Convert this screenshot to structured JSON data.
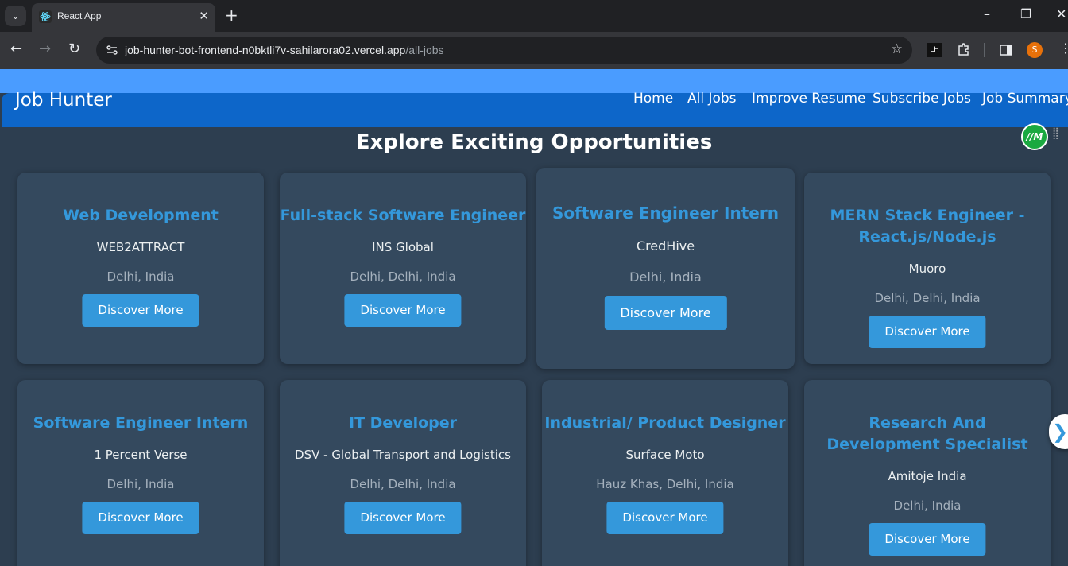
{
  "browser": {
    "tab_title": "React App",
    "url_host": "job-hunter-bot-frontend-n0bktli7v-sahilarora02.vercel.app",
    "url_path": "/all-jobs",
    "profile_initial": "S"
  },
  "navbar": {
    "brand": "Job Hunter",
    "links": [
      "Home",
      "All Jobs",
      "Improve Resume",
      "Subscribe Jobs",
      "Job Summary"
    ]
  },
  "page_heading": "Explore Exciting Opportunities",
  "jobs": [
    {
      "title": "Web Development",
      "company": "WEB2ATTRACT",
      "location": "Delhi, India",
      "button": "Discover More"
    },
    {
      "title": "Full-stack Software Engineer",
      "company": "INS Global",
      "location": "Delhi, Delhi, India",
      "button": "Discover More"
    },
    {
      "title": "Software Engineer Intern",
      "company": "CredHive",
      "location": "Delhi, India",
      "button": "Discover More"
    },
    {
      "title": "MERN Stack Engineer - React.js/Node.js",
      "company": "Muoro",
      "location": "Delhi, Delhi, India",
      "button": "Discover More"
    },
    {
      "title": "Software Engineer Intern",
      "company": "1 Percent Verse",
      "location": "Delhi, India",
      "button": "Discover More"
    },
    {
      "title": "IT Developer",
      "company": "DSV - Global Transport and Logistics",
      "location": "Delhi, Delhi, India",
      "button": "Discover More"
    },
    {
      "title": "Industrial/ Product Designer",
      "company": "Surface Moto",
      "location": "Hauz Khas, Delhi, India",
      "button": "Discover More"
    },
    {
      "title": "Research And Development Specialist",
      "company": "Amitoje India",
      "location": "Delhi, India",
      "button": "Discover More"
    }
  ],
  "extension_badge": "//M",
  "colors": {
    "navbar": "#0d66c9",
    "accent": "#3498db",
    "card": "#34495e",
    "page_bg": "#2d3e50"
  }
}
